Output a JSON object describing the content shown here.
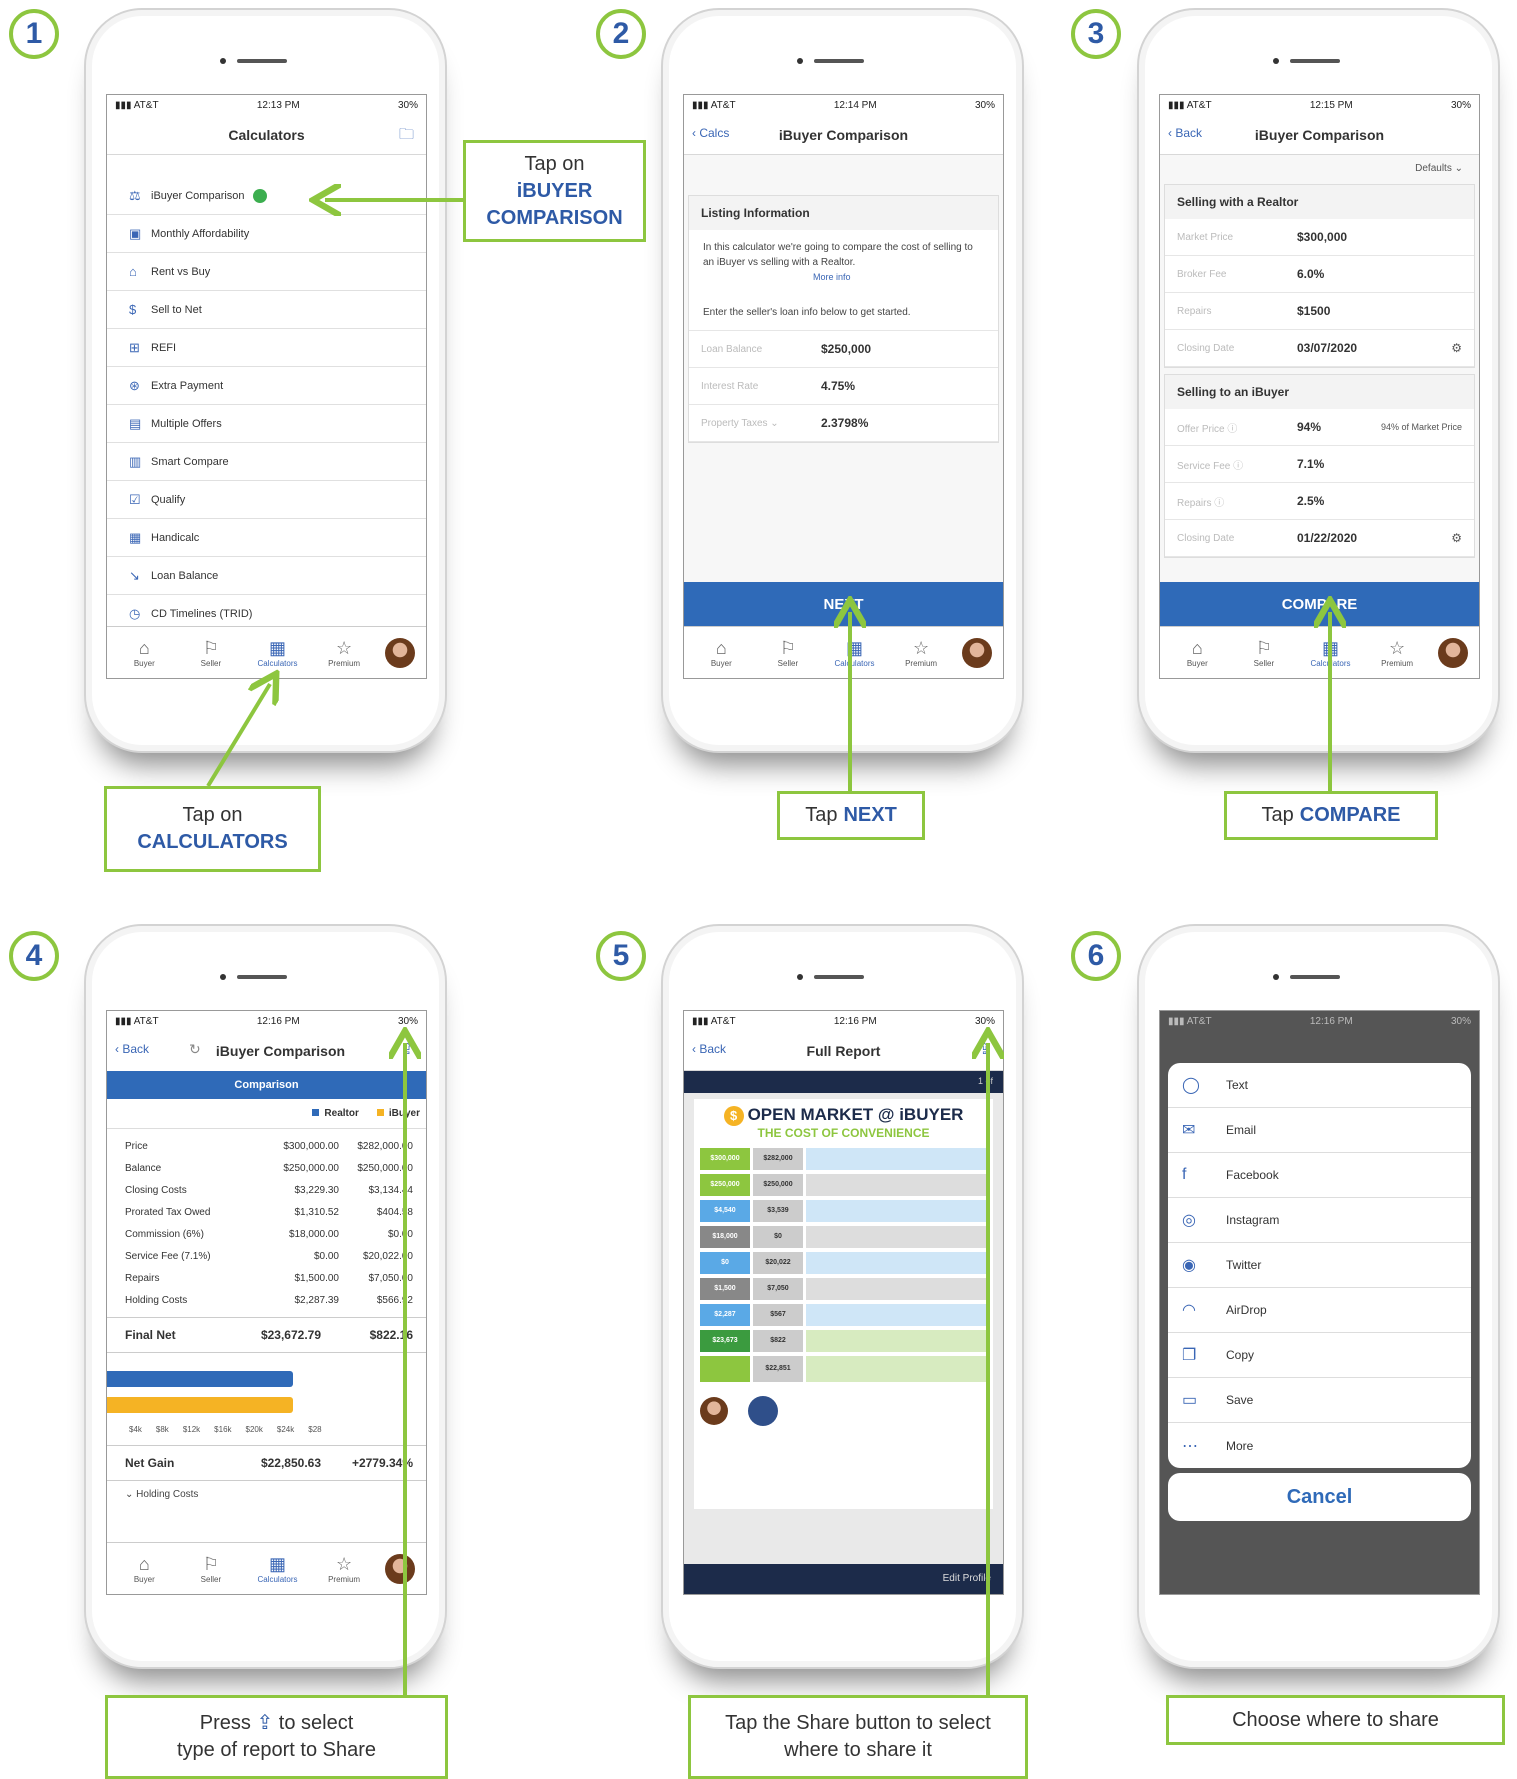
{
  "steps": [
    "1",
    "2",
    "3",
    "4",
    "5",
    "6"
  ],
  "common": {
    "carrier": "AT&T",
    "battery": "30%",
    "tabs": [
      "Buyer",
      "Seller",
      "Calculators",
      "Premium"
    ]
  },
  "screen1": {
    "time": "12:13 PM",
    "title": "Calculators",
    "items": [
      {
        "icon": "⚖",
        "label": "iBuyer Comparison"
      },
      {
        "icon": "▣",
        "label": "Monthly Affordability"
      },
      {
        "icon": "⌂",
        "label": "Rent vs Buy"
      },
      {
        "icon": "$",
        "label": "Sell to Net"
      },
      {
        "icon": "⊞",
        "label": "REFI"
      },
      {
        "icon": "⊛",
        "label": "Extra Payment"
      },
      {
        "icon": "▤",
        "label": "Multiple Offers"
      },
      {
        "icon": "▥",
        "label": "Smart Compare"
      },
      {
        "icon": "☑",
        "label": "Qualify"
      },
      {
        "icon": "▦",
        "label": "Handicalc"
      },
      {
        "icon": "↘",
        "label": "Loan Balance"
      },
      {
        "icon": "◷",
        "label": "CD Timelines (TRID)"
      }
    ]
  },
  "screen2": {
    "time": "12:14 PM",
    "back": "Calcs",
    "title": "iBuyer Comparison",
    "card_title": "Listing Information",
    "intro": "In this calculator we're going to compare the cost of selling to an iBuyer vs selling with a Realtor.",
    "more_info": "More info",
    "prompt": "Enter the seller's loan info below to get started.",
    "rows": [
      {
        "label": "Loan Balance",
        "value": "$250,000"
      },
      {
        "label": "Interest Rate",
        "value": "4.75%"
      },
      {
        "label": "Property Taxes",
        "value": "2.3798%"
      }
    ],
    "button": "NEXT"
  },
  "screen3": {
    "time": "12:15 PM",
    "back": "Back",
    "title": "iBuyer Comparison",
    "defaults": "Defaults",
    "realtor_title": "Selling with a Realtor",
    "realtor_rows": [
      {
        "label": "Market Price",
        "value": "$300,000"
      },
      {
        "label": "Broker Fee",
        "value": "6.0%"
      },
      {
        "label": "Repairs",
        "value": "$1500"
      },
      {
        "label": "Closing Date",
        "value": "03/07/2020"
      }
    ],
    "ibuyer_title": "Selling to an iBuyer",
    "ibuyer_rows": [
      {
        "label": "Offer Price",
        "value": "94%",
        "extra": "94% of Market Price"
      },
      {
        "label": "Service Fee",
        "value": "7.1%"
      },
      {
        "label": "Repairs",
        "value": "2.5%"
      },
      {
        "label": "Closing Date",
        "value": "01/22/2020"
      }
    ],
    "button": "COMPARE"
  },
  "screen4": {
    "time": "12:16 PM",
    "back": "Back",
    "title": "iBuyer Comparison",
    "header": "Comparison",
    "legend": [
      "Realtor",
      "iBuyer"
    ],
    "rows": [
      {
        "label": "Price",
        "realtor": "$300,000.00",
        "ibuyer": "$282,000.00"
      },
      {
        "label": "Balance",
        "realtor": "$250,000.00",
        "ibuyer": "$250,000.00"
      },
      {
        "label": "Closing Costs",
        "realtor": "$3,229.30",
        "ibuyer": "$3,134.44"
      },
      {
        "label": "Prorated Tax Owed",
        "realtor": "$1,310.52",
        "ibuyer": "$404.58"
      },
      {
        "label": "Commission (6%)",
        "realtor": "$18,000.00",
        "ibuyer": "$0.00"
      },
      {
        "label": "Service Fee (7.1%)",
        "realtor": "$0.00",
        "ibuyer": "$20,022.00"
      },
      {
        "label": "Repairs",
        "realtor": "$1,500.00",
        "ibuyer": "$7,050.00"
      },
      {
        "label": "Holding Costs",
        "realtor": "$2,287.39",
        "ibuyer": "$566.92"
      }
    ],
    "final_net": {
      "label": "Final Net",
      "realtor": "$23,672.79",
      "ibuyer": "$822.16"
    },
    "chart_ticks": [
      "$4k",
      "$8k",
      "$12k",
      "$16k",
      "$20k",
      "$24k",
      "$28"
    ],
    "net_gain": {
      "label": "Net Gain",
      "realtor": "$22,850.63",
      "ibuyer": "+2779.34%"
    },
    "holding": "Holding Costs",
    "bar_colors": {
      "realtor": "#2f6ab8",
      "ibuyer": "#f5b324"
    }
  },
  "screen5": {
    "time": "12:16 PM",
    "back": "Back",
    "title": "Full Report",
    "page": "1 of",
    "report_title": "OPEN MARKET @ iBUYER",
    "report_subtitle": "THE COST OF CONVENIENCE",
    "report_rows": [
      [
        "$300,000",
        "$282,000"
      ],
      [
        "$250,000",
        "$250,000"
      ],
      [
        "$4,540",
        "$3,539"
      ],
      [
        "$18,000",
        "$0"
      ],
      [
        "$0",
        "$20,022"
      ],
      [
        "$1,500",
        "$7,050"
      ],
      [
        "$2,287",
        "$567"
      ],
      [
        "$23,673",
        "$822"
      ],
      [
        "",
        "$22,851"
      ]
    ],
    "footer": "Edit Profile"
  },
  "screen6": {
    "time": "12:16 PM",
    "items": [
      {
        "icon": "◯",
        "label": "Text"
      },
      {
        "icon": "✉",
        "label": "Email"
      },
      {
        "icon": "f",
        "label": "Facebook"
      },
      {
        "icon": "◎",
        "label": "Instagram"
      },
      {
        "icon": "◉",
        "label": "Twitter"
      },
      {
        "icon": "◠",
        "label": "AirDrop"
      },
      {
        "icon": "❐",
        "label": "Copy"
      },
      {
        "icon": "▭",
        "label": "Save"
      },
      {
        "icon": "⋯",
        "label": "More"
      }
    ],
    "cancel": "Cancel"
  },
  "callouts": {
    "c1_pre": "Tap on",
    "c1_em": "iBUYER COMPARISON",
    "c2_pre": "Tap on",
    "c2_em": "CALCULATORS",
    "c3_pre": "Tap",
    "c3_em": "NEXT",
    "c4_pre": "Tap",
    "c4_em": "COMPARE",
    "c5_a": "Press",
    "c5_b": "to select",
    "c5_c": "type of report to Share",
    "c6": "Tap the Share button to select where to share it",
    "c7": "Choose where to share"
  }
}
